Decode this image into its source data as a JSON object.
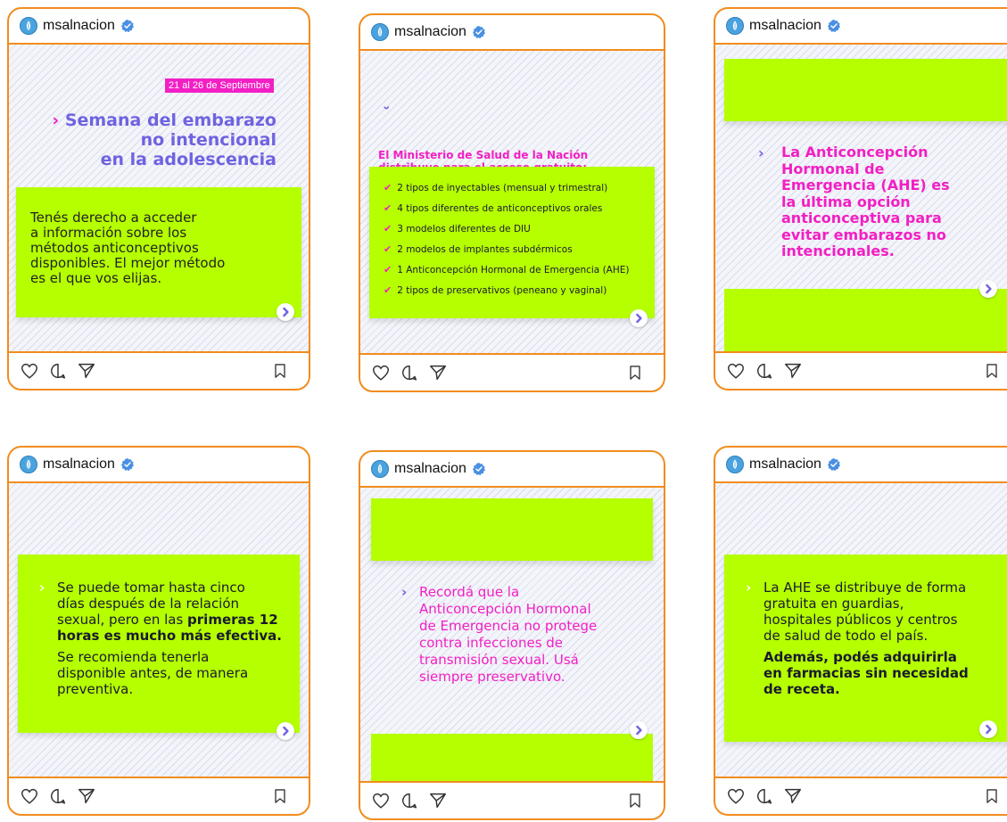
{
  "account": {
    "username": "msalnacion"
  },
  "icons": {
    "like": "heart-outline-icon",
    "comment": "comment-outline-icon",
    "share": "send-outline-icon",
    "save": "bookmark-outline-icon",
    "next": "chevron-right-circle-icon",
    "verified": "verified-badge-icon"
  },
  "colors": {
    "border": "#f28c1e",
    "green": "#b5ff00",
    "pink": "#f21fc4",
    "purple": "#6f63e0",
    "verified": "#4a90e2"
  },
  "posts": [
    {
      "tag": "21 al 26 de Septiembre",
      "title_line1": "Semana del embarazo",
      "title_line2": "no intencional",
      "title_line3": "en la adolescencia",
      "body_lines": [
        "Tenés derecho a acceder",
        "a información sobre los",
        "métodos anticonceptivos",
        "disponibles. El mejor método",
        "es el que vos elijas."
      ]
    },
    {
      "heading_line1": "El Ministerio de Salud de la Nación",
      "heading_line2": "distribuye para el acceso gratuito:",
      "items": [
        "2 tipos de inyectables (mensual y trimestral)",
        "4 tipos diferentes de anticonceptivos orales",
        "3 modelos diferentes de DIU",
        "2 modelos de implantes subdérmicos",
        "1 Anticoncepción Hormonal de Emergencia (AHE)",
        "2 tipos de preservativos (peneano y vaginal)"
      ]
    },
    {
      "lines": [
        "La Anticoncepción",
        "Hormonal de",
        "Emergencia (AHE) es",
        "la última opción",
        "anticonceptiva para",
        "evitar embarazos no",
        "intencionales."
      ]
    },
    {
      "lines_a": [
        "Se puede tomar hasta cinco",
        "días después de la relación",
        "sexual, pero en las "
      ],
      "bold_a": "primeras 12",
      "bold_b": "horas es mucho más efectiva.",
      "lines_b": [
        "Se recomienda tenerla",
        "disponible antes, de manera",
        "preventiva."
      ]
    },
    {
      "lines": [
        "Recordá que la",
        "Anticoncepción Hormonal",
        "de Emergencia no protege",
        "contra infecciones de",
        "transmisión sexual. Usá",
        "siempre preservativo."
      ]
    },
    {
      "lines_a": [
        "La AHE se distribuye de forma",
        "gratuita en guardias,",
        "hospitales públicos y centros",
        "de salud de todo el país."
      ],
      "lines_b": [
        "Además, podés adquirirla",
        "en farmacias sin necesidad",
        "de receta."
      ]
    }
  ]
}
